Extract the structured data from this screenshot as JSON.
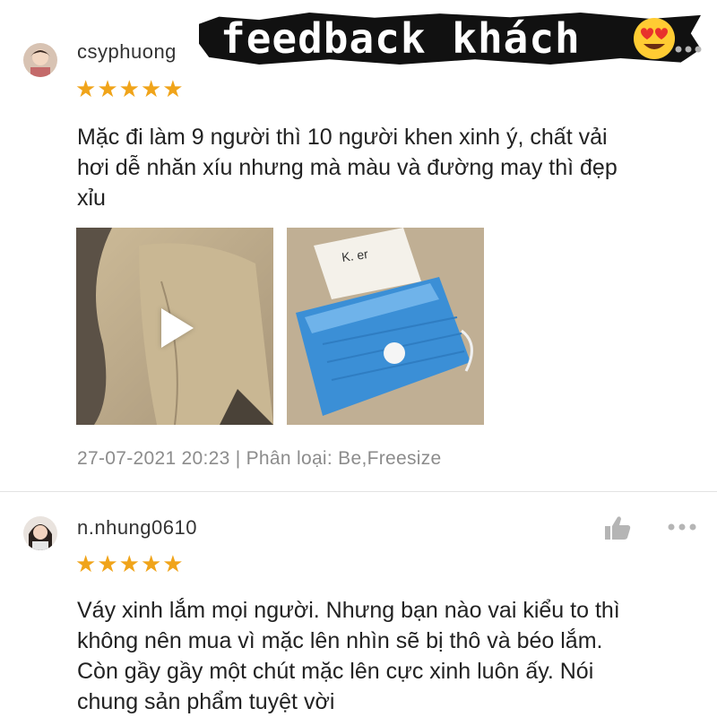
{
  "banner": {
    "text": "feedback khách",
    "emoji": "heart-eyes-emoji"
  },
  "reviews": [
    {
      "username": "csyphuong",
      "rating": 5,
      "stars": [
        "★",
        "★",
        "★",
        "★",
        "★"
      ],
      "text_lines": [
        "Mặc đi làm 9 người thì 10 người khen xinh ý, chất vải",
        "hơi dễ nhăn xíu nhưng mà màu và đường may thì đẹp",
        "xỉu"
      ],
      "media": [
        {
          "kind": "video",
          "icon": "play-icon"
        },
        {
          "kind": "photo",
          "tag_text": "K. er"
        }
      ],
      "meta": "27-07-2021 20:23 | Phân loại: Be,Freesize"
    },
    {
      "username": "n.nhung0610",
      "rating": 5,
      "stars": [
        "★",
        "★",
        "★",
        "★",
        "★"
      ],
      "text_lines": [
        "Váy xinh lắm mọi người. Nhưng bạn nào vai kiểu to thì",
        "không nên mua vì mặc lên nhìn sẽ bị thô và béo lắm.",
        "Còn gầy gầy một chút mặc lên cực xinh luôn ấy. Nói",
        "chung sản phẩm tuyệt vời"
      ],
      "like_icon": "thumbs-up-icon",
      "more_icon": "more-dots-icon"
    }
  ],
  "colors": {
    "star": "#f0a41a",
    "meta": "#8c8c8c",
    "icon": "#b5b5b5",
    "banner_bg": "#111111"
  }
}
